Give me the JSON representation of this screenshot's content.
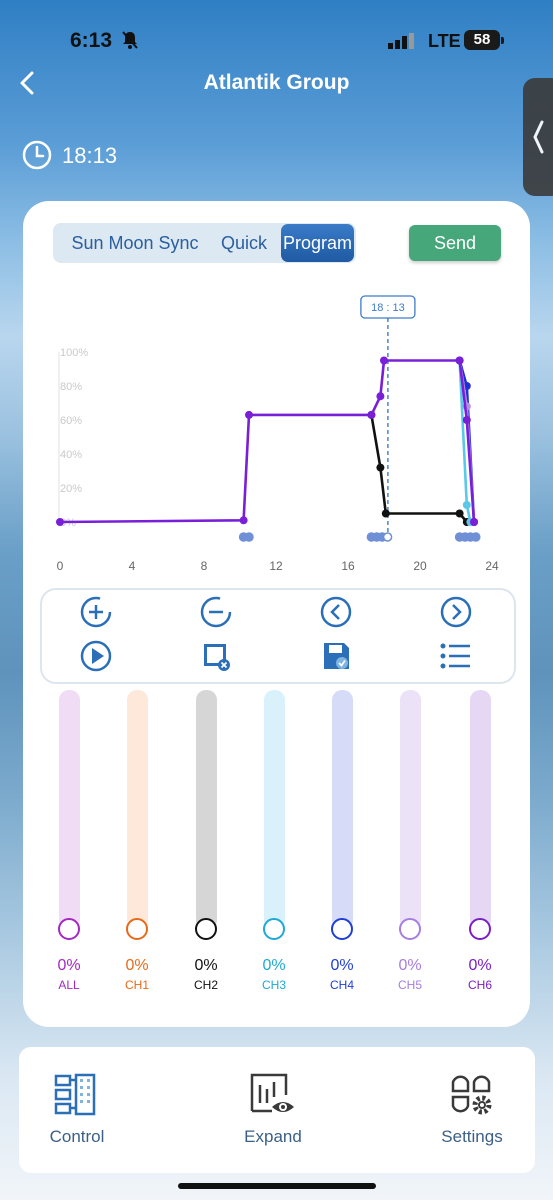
{
  "status": {
    "time": "6:13",
    "network": "LTE",
    "battery": "58"
  },
  "header": {
    "title": "Atlantik Group",
    "clock_time": "18:13"
  },
  "tabs": [
    {
      "label": "Sun Moon Sync",
      "active": false
    },
    {
      "label": "Quick",
      "active": false
    },
    {
      "label": "Program",
      "active": true
    }
  ],
  "send_label": "Send",
  "chart_data": {
    "type": "line",
    "cursor_label": "18 : 13",
    "cursor_x": 18.2167,
    "x_ticks": [
      "0",
      "4",
      "8",
      "12",
      "16",
      "20",
      "24"
    ],
    "xlim": [
      0,
      24
    ],
    "y_ticks": [
      "100%",
      "80%",
      "60%",
      "40%",
      "20%",
      "0%"
    ],
    "ylim": [
      0,
      100
    ],
    "series": [
      {
        "color": "#7a1fd8",
        "x": [
          0,
          10.2,
          10.5,
          17.3,
          17.8,
          18.0,
          22.2,
          22.6,
          23.0
        ],
        "y": [
          0,
          1,
          63,
          63,
          74,
          95,
          95,
          60,
          0
        ]
      },
      {
        "color": "#111111",
        "x": [
          17.3,
          17.8,
          18.1,
          22.2,
          22.6,
          23.0
        ],
        "y": [
          63,
          32,
          5,
          5,
          0,
          0
        ]
      },
      {
        "color": "#1f2fd8",
        "x": [
          22.2,
          22.6,
          23.0
        ],
        "y": [
          95,
          80,
          0
        ]
      },
      {
        "color": "#5ac8e8",
        "x": [
          22.2,
          22.6,
          22.8
        ],
        "y": [
          95,
          10,
          0
        ]
      },
      {
        "color": "#b48ee0",
        "x": [
          22.2,
          22.6,
          23.0
        ],
        "y": [
          95,
          68,
          0
        ]
      }
    ],
    "markers_x": [
      10.2,
      10.5,
      17.3,
      17.6,
      17.9,
      18.2,
      22.2,
      22.5,
      22.8,
      23.1
    ]
  },
  "controls": [
    "add-point-icon",
    "remove-point-icon",
    "previous-point-icon",
    "next-point-icon",
    "play-preview-icon",
    "clear-icon",
    "save-icon",
    "list-icon"
  ],
  "channels": [
    {
      "label": "ALL",
      "value": "0%",
      "color": "#a429c4",
      "track": "#f0dcf4",
      "level": 0
    },
    {
      "label": "CH1",
      "value": "0%",
      "color": "#e86a18",
      "track": "#fde8da",
      "level": 0
    },
    {
      "label": "CH2",
      "value": "0%",
      "color": "#111111",
      "track": "#d6d6d6",
      "level": 0
    },
    {
      "label": "CH3",
      "value": "0%",
      "color": "#1ea8d8",
      "track": "#d8f1fa",
      "level": 0
    },
    {
      "label": "CH4",
      "value": "0%",
      "color": "#1f3ed8",
      "track": "#d6dcf8",
      "level": 0
    },
    {
      "label": "CH5",
      "value": "0%",
      "color": "#a67ee0",
      "track": "#ebe2f8",
      "level": 0
    },
    {
      "label": "CH6",
      "value": "0%",
      "color": "#7a1fc8",
      "track": "#e6d8f4",
      "level": 0
    }
  ],
  "nav": [
    {
      "label": "Control",
      "icon": "control-icon"
    },
    {
      "label": "Expand",
      "icon": "expand-icon"
    },
    {
      "label": "Settings",
      "icon": "settings-icon"
    }
  ]
}
